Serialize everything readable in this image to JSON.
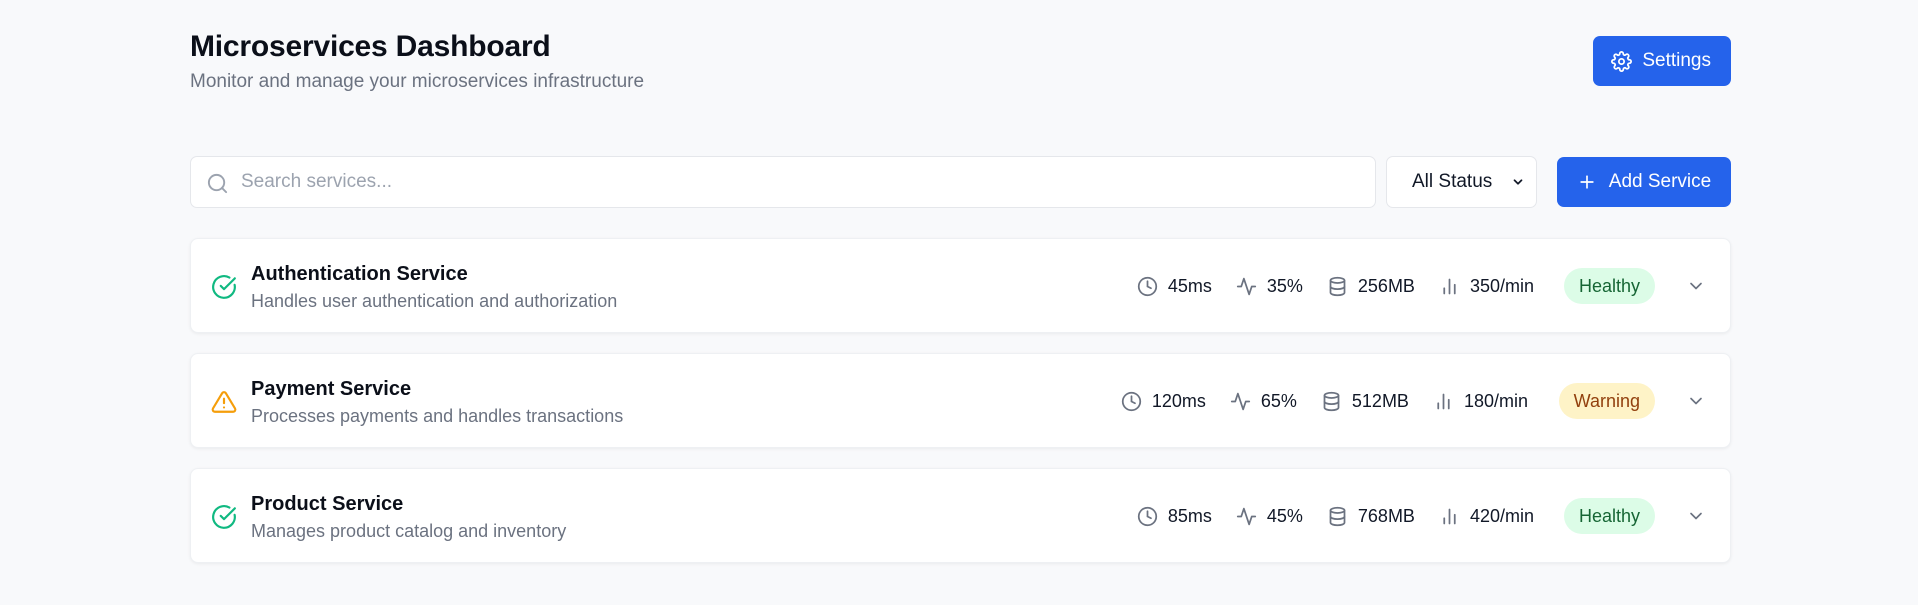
{
  "header": {
    "title": "Microservices Dashboard",
    "subtitle": "Monitor and manage your microservices infrastructure",
    "settings_label": "Settings"
  },
  "toolbar": {
    "search_placeholder": "Search services...",
    "search_value": "",
    "status_filter": "All Status",
    "add_label": "Add Service"
  },
  "colors": {
    "primary": "#2563eb",
    "healthy": "#10b981",
    "warning": "#f59e0b"
  },
  "services": [
    {
      "name": "Authentication Service",
      "description": "Handles user authentication and authorization",
      "status": "Healthy",
      "status_icon": "check-circle-icon",
      "latency": "45ms",
      "cpu": "35%",
      "memory": "256MB",
      "requests": "350/min"
    },
    {
      "name": "Payment Service",
      "description": "Processes payments and handles transactions",
      "status": "Warning",
      "status_icon": "warning-triangle-icon",
      "latency": "120ms",
      "cpu": "65%",
      "memory": "512MB",
      "requests": "180/min"
    },
    {
      "name": "Product Service",
      "description": "Manages product catalog and inventory",
      "status": "Healthy",
      "status_icon": "check-circle-icon",
      "latency": "85ms",
      "cpu": "45%",
      "memory": "768MB",
      "requests": "420/min"
    }
  ]
}
